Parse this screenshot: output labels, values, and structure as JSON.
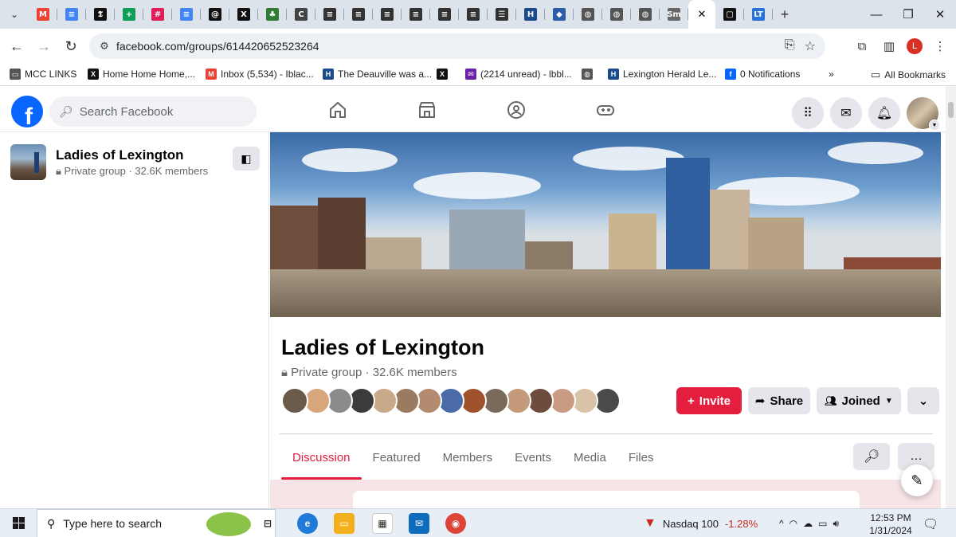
{
  "browser": {
    "tabs": [
      {
        "icon": "gmail-icon",
        "glyph": "M",
        "color": "#ea4335"
      },
      {
        "icon": "docs-icon",
        "glyph": "≡",
        "color": "#4285f4"
      },
      {
        "icon": "nyt-icon",
        "glyph": "𝕿",
        "color": "#111111"
      },
      {
        "icon": "sheets-icon",
        "glyph": "+",
        "color": "#0f9d58"
      },
      {
        "icon": "slack-icon",
        "glyph": "#",
        "color": "#e01e5a"
      },
      {
        "icon": "docs-icon",
        "glyph": "≡",
        "color": "#4285f4"
      },
      {
        "icon": "threads-icon",
        "glyph": "@",
        "color": "#111111"
      },
      {
        "icon": "x-icon",
        "glyph": "X",
        "color": "#111111"
      },
      {
        "icon": "tree-icon",
        "glyph": "♣",
        "color": "#2e7d32"
      },
      {
        "icon": "cuc-icon",
        "glyph": "C",
        "color": "#444444"
      },
      {
        "icon": "doc-icon",
        "glyph": "≡",
        "color": "#333333"
      },
      {
        "icon": "doc-icon",
        "glyph": "≡",
        "color": "#333333"
      },
      {
        "icon": "doc-icon",
        "glyph": "≡",
        "color": "#333333"
      },
      {
        "icon": "doc-icon",
        "glyph": "≡",
        "color": "#333333"
      },
      {
        "icon": "doc-icon",
        "glyph": "≡",
        "color": "#333333"
      },
      {
        "icon": "doc-icon",
        "glyph": "≡",
        "color": "#333333"
      },
      {
        "icon": "lines-icon",
        "glyph": "☰",
        "color": "#333333"
      },
      {
        "icon": "herald-leader-icon",
        "glyph": "H",
        "color": "#1a4a8a"
      },
      {
        "icon": "diamond-icon",
        "glyph": "◆",
        "color": "#2a5ea8"
      },
      {
        "icon": "globe-icon",
        "glyph": "◍",
        "color": "#555555"
      },
      {
        "icon": "globe-icon",
        "glyph": "◍",
        "color": "#555555"
      },
      {
        "icon": "globe-icon",
        "glyph": "◍",
        "color": "#555555"
      },
      {
        "icon": "sm-icon",
        "glyph": "Sm",
        "color": "#666666"
      }
    ],
    "active_tab_close": "✕",
    "after_tabs": [
      {
        "icon": "square-icon",
        "glyph": "▢",
        "color": "#111111"
      },
      {
        "icon": "lt-icon",
        "glyph": "LT",
        "color": "#2a72d8"
      }
    ],
    "new_tab": "+",
    "url": "facebook.com/groups/614420652523264"
  },
  "bookmarks": [
    {
      "label": "MCC LINKS",
      "icon": "folder-icon",
      "glyph": "▭",
      "color": "#555555"
    },
    {
      "label": "Home Home Home,...",
      "icon": "x-icon",
      "glyph": "X",
      "color": "#111111"
    },
    {
      "label": "Inbox (5,534) - Iblac...",
      "icon": "gmail-icon",
      "glyph": "M",
      "color": "#ea4335"
    },
    {
      "label": "The Deauville was a...",
      "icon": "h-circle-icon",
      "glyph": "H",
      "color": "#1a4a8a"
    },
    {
      "label": "",
      "icon": "x-icon",
      "glyph": "X",
      "color": "#111111"
    },
    {
      "label": "(2214 unread) - lbbl...",
      "icon": "mail-icon",
      "glyph": "✉",
      "color": "#6b21a8"
    },
    {
      "label": "",
      "icon": "globe-icon",
      "glyph": "◍",
      "color": "#555555"
    },
    {
      "label": "Lexington Herald Le...",
      "icon": "herald-leader-icon",
      "glyph": "H",
      "color": "#1a4a8a"
    },
    {
      "label": "0 Notifications",
      "icon": "facebook-icon",
      "glyph": "f",
      "color": "#0866ff"
    }
  ],
  "bookmarks_overflow": "»",
  "all_bookmarks": "All Bookmarks",
  "facebook": {
    "search_placeholder": "Search Facebook",
    "logo": "f"
  },
  "sidebar": {
    "group_name": "Ladies of Lexington",
    "group_meta": "Private group · 32.6K members"
  },
  "group": {
    "name": "Ladies of Lexington",
    "meta": "Private group · 32.6K members",
    "invite_label": "Invite",
    "share_label": "Share",
    "joined_label": "Joined",
    "member_avatar_colors": [
      "#6b5a4a",
      "#d7a67a",
      "#8b8b8b",
      "#3b3b3b",
      "#c8a98a",
      "#9a7b5f",
      "#b38c70",
      "#4b6aa8",
      "#a0522d",
      "#7a6a5a",
      "#c49a7a",
      "#6d4c3d",
      "#c99b83",
      "#d9c3a8",
      "#4a4a4a"
    ]
  },
  "tabs": [
    "Discussion",
    "Featured",
    "Members",
    "Events",
    "Media",
    "Files"
  ],
  "active_tab": "Discussion",
  "taskbar": {
    "search_placeholder": "Type here to search",
    "ticker_name": "Nasdaq 100",
    "ticker_change": "-1.28%",
    "time": "12:53 PM",
    "date": "1/31/2024"
  },
  "colors": {
    "accent": "#e41e3f",
    "facebook_blue": "#0866ff"
  }
}
